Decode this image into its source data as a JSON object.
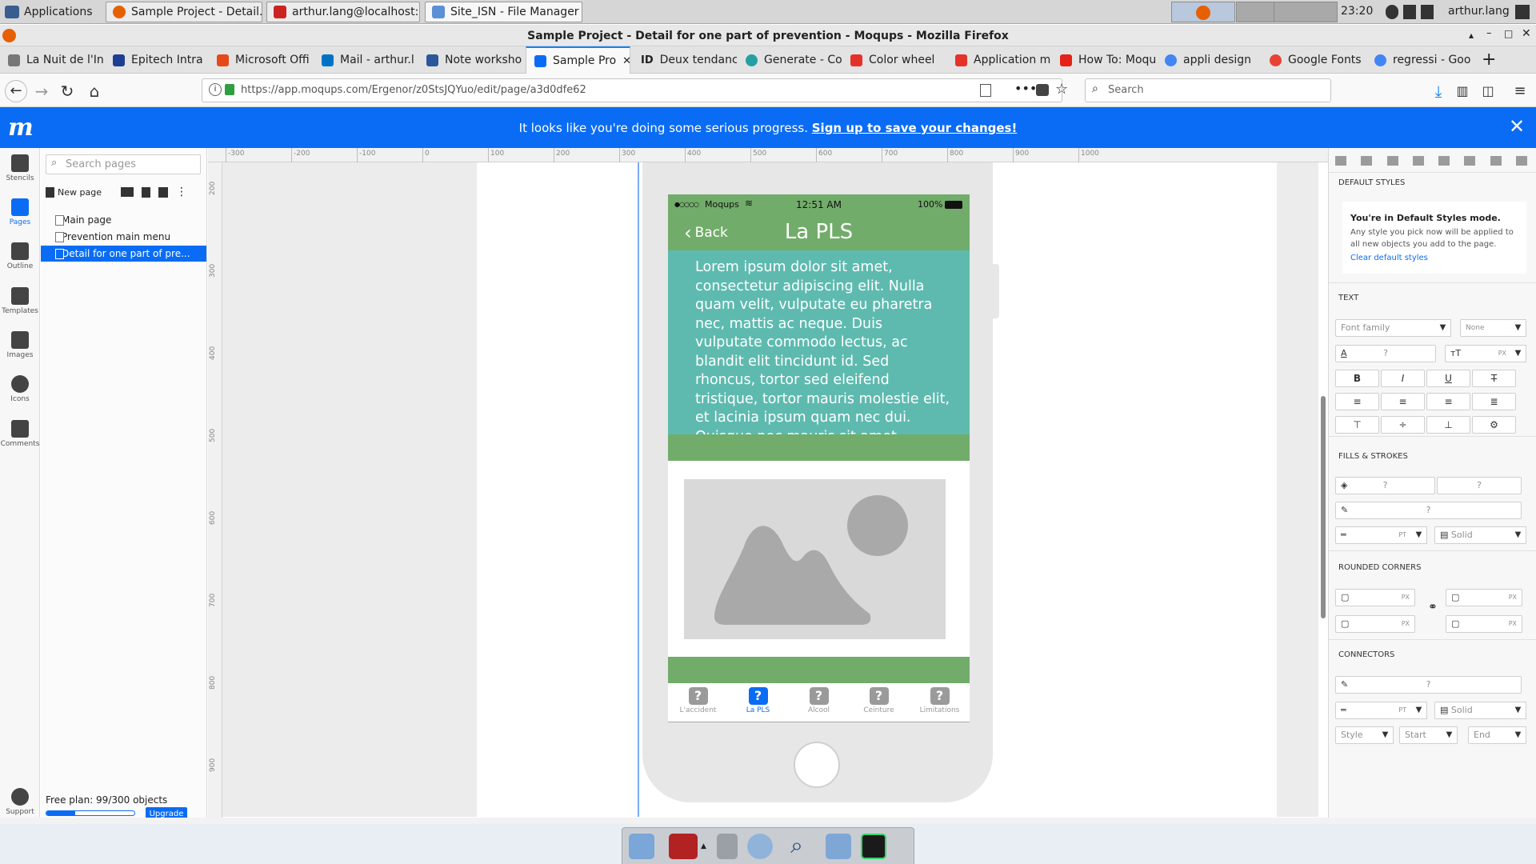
{
  "os": {
    "applications_label": "Applications",
    "tasks": [
      {
        "label": "Sample Project - Detail...",
        "color": "#e66000"
      },
      {
        "label": "arthur.lang@localhost: ...",
        "color": "#cc2222"
      },
      {
        "label": "Site_ISN - File Manager",
        "color": "#5b8fd6"
      }
    ],
    "clock": "23:20",
    "user": "arthur.lang"
  },
  "firefox": {
    "window_title": "Sample Project - Detail for one part of prevention - Moqups - Mozilla Firefox",
    "tabs": [
      {
        "label": "La Nuit de l'In",
        "color": "#777777"
      },
      {
        "label": "Epitech Intra",
        "color": "#1c3f94"
      },
      {
        "label": "Microsoft Offi",
        "color": "#e64a19"
      },
      {
        "label": "Mail - arthur.l",
        "color": "#0072c6"
      },
      {
        "label": "Note worksho",
        "color": "#2b579a"
      },
      {
        "label": "Sample Pro",
        "color": "#0a6cf5",
        "active": true
      },
      {
        "label": "Deux tendanc",
        "color": "#444444"
      },
      {
        "label": "Generate - Co",
        "color": "#24a0a4"
      },
      {
        "label": "Color wheel",
        "color": "#e4322b"
      },
      {
        "label": "Application m",
        "color": "#e4322b"
      },
      {
        "label": "How To: Moqu",
        "color": "#e62117"
      },
      {
        "label": "appli design",
        "color": "#4285f4"
      },
      {
        "label": "Google Fonts",
        "color": "#e84335"
      },
      {
        "label": "regressi - Goo",
        "color": "#4285f4"
      }
    ],
    "url": "https://app.moqups.com/Ergenor/z0StsJQYuo/edit/page/a3d0dfe62",
    "search_placeholder": "Search"
  },
  "banner": {
    "logo": "m",
    "message": "It looks like you're doing some serious progress.",
    "cta": "Sign up to save your changes!"
  },
  "rail": [
    {
      "label": "Stencils",
      "icon": "stencils-icon"
    },
    {
      "label": "Pages",
      "icon": "pages-icon",
      "active": true
    },
    {
      "label": "Outline",
      "icon": "outline-icon"
    },
    {
      "label": "Templates",
      "icon": "templates-icon"
    },
    {
      "label": "Images",
      "icon": "images-icon"
    },
    {
      "label": "Icons",
      "icon": "club-icon"
    },
    {
      "label": "Comments",
      "icon": "comments-icon"
    }
  ],
  "rail_support": "Support",
  "pages_panel": {
    "search_placeholder": "Search pages",
    "new_page": "New page",
    "pages": [
      "Main page",
      "Prevention main menu",
      "Detail for one part of pre..."
    ],
    "selected_index": 2,
    "plan_label": "Free plan: 99/300 objects",
    "plan_progress": 0.33,
    "upgrade": "Upgrade"
  },
  "rulers": {
    "top": [
      "-300",
      "-200",
      "-100",
      "0",
      "100",
      "200",
      "300",
      "400",
      "500",
      "600",
      "700",
      "800",
      "900",
      "1000"
    ],
    "left": [
      "200",
      "300",
      "400",
      "500",
      "600",
      "700",
      "800",
      "900"
    ]
  },
  "phone": {
    "carrier": "Moqups",
    "time": "12:51 AM",
    "battery": "100%",
    "back": "Back",
    "title": "La PLS",
    "lorem": "Lorem ipsum dolor sit amet, consectetur adipiscing elit. Nulla quam velit, vulputate eu pharetra nec, mattis ac neque. Duis vulputate commodo lectus, ac blandit elit tincidunt id. Sed rhoncus, tortor sed eleifend tristique, tortor mauris molestie elit, et lacinia ipsum quam nec dui. Quisque nec mauris sit amet",
    "tabs": [
      {
        "label": "L'accident"
      },
      {
        "label": "La PLS",
        "active": true
      },
      {
        "label": "Alcool"
      },
      {
        "label": "Ceinture"
      },
      {
        "label": "Limitations"
      }
    ],
    "tab_glyph": "?"
  },
  "right_panel": {
    "default_styles": "DEFAULT STYLES",
    "defaults_title": "You're in Default Styles mode.",
    "defaults_text": "Any style you pick now will be applied to all new objects you add to the page.",
    "defaults_link": "Clear default styles",
    "text_section": "TEXT",
    "font_family": "Font family",
    "font_none": "None",
    "q": "?",
    "px": "PX",
    "pt": "PT",
    "solid": "Solid",
    "fills_section": "FILLS & STROKES",
    "rounded_section": "ROUNDED CORNERS",
    "connectors_section": "CONNECTORS",
    "style": "Style",
    "start": "Start",
    "end": "End",
    "bold": "B",
    "italic": "I",
    "underline": "U",
    "strike": "T"
  },
  "colors": {
    "brand": "#0a6cf5",
    "phone_green": "#72ac6a",
    "phone_teal": "#5ebaaf"
  }
}
